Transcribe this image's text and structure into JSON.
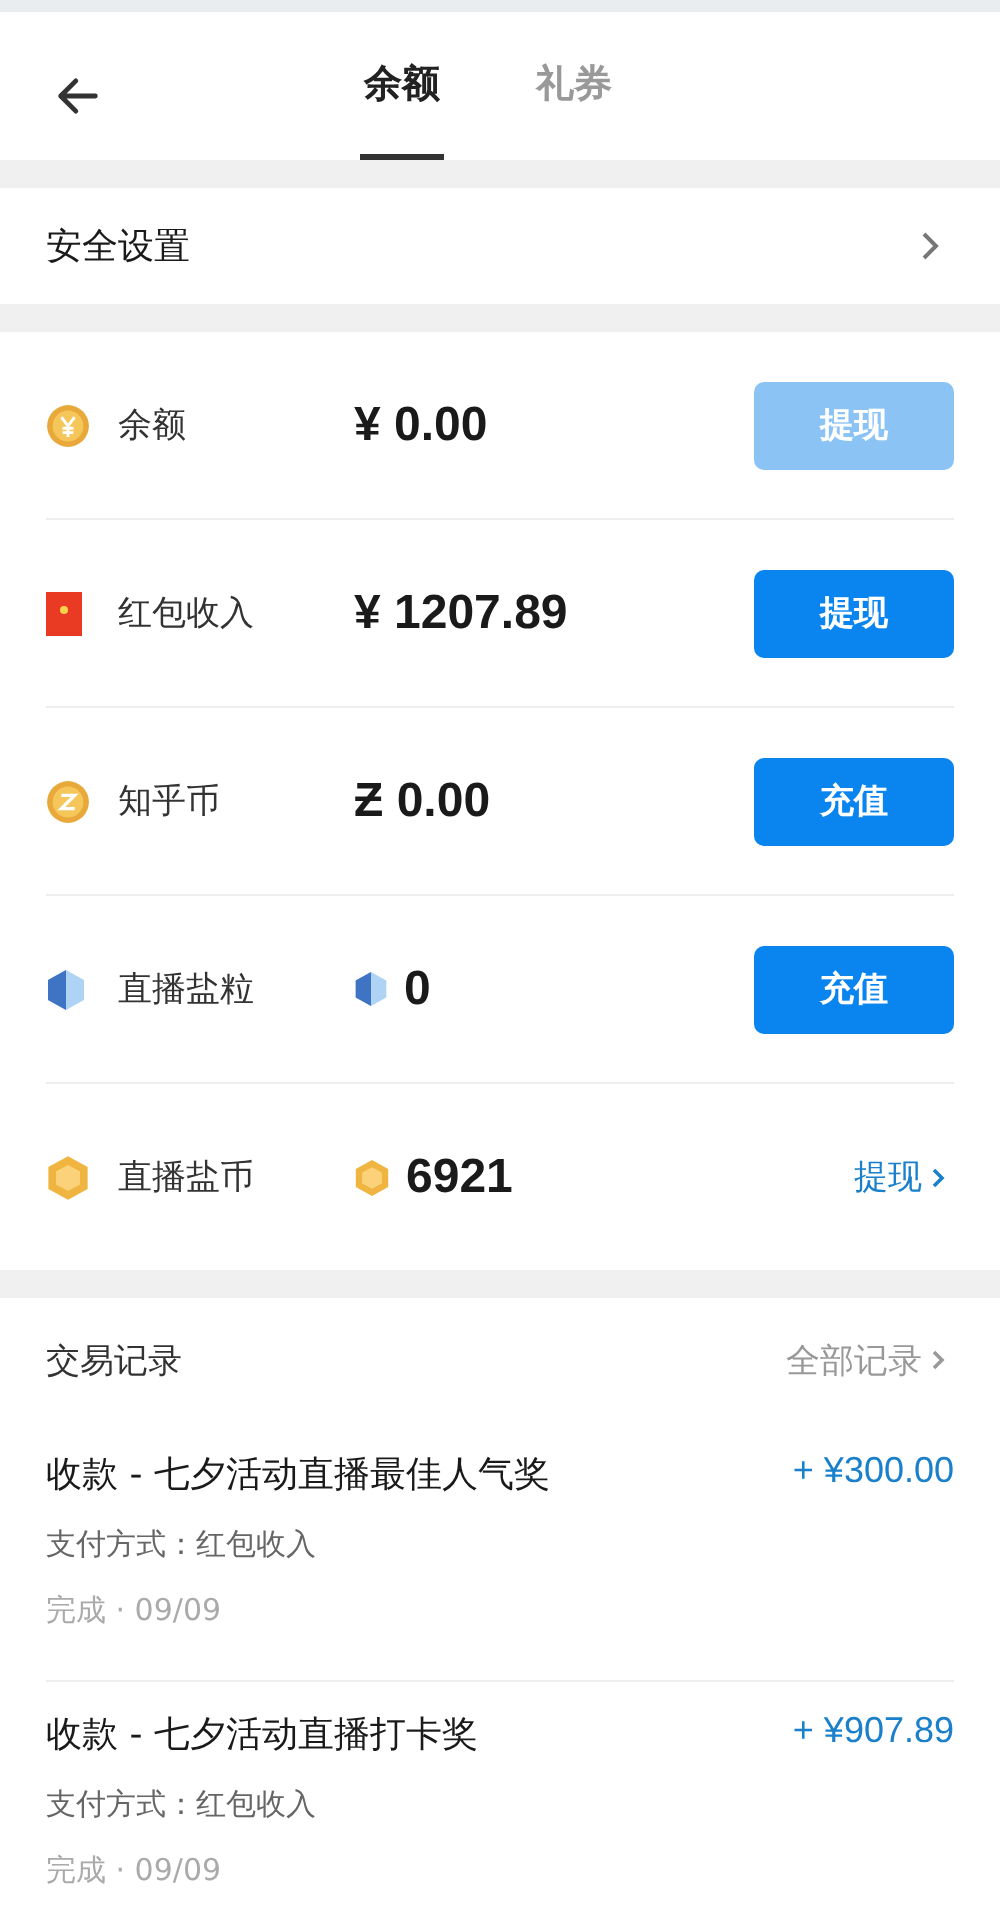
{
  "tabs": [
    {
      "label": "余额",
      "selected": true
    },
    {
      "label": "礼券",
      "selected": false
    }
  ],
  "security": {
    "label": "安全设置"
  },
  "balances": [
    {
      "label": "余额",
      "amount": "¥ 0.00",
      "action": {
        "kind": "button",
        "label": "提现",
        "disabled": true
      }
    },
    {
      "label": "红包收入",
      "amount": "¥ 1207.89",
      "action": {
        "kind": "button",
        "label": "提现",
        "disabled": false
      }
    },
    {
      "label": "知乎币",
      "amount": "Ƶ 0.00",
      "action": {
        "kind": "button",
        "label": "充值",
        "disabled": false
      }
    },
    {
      "label": "直播盐粒",
      "amount": "0",
      "action": {
        "kind": "button",
        "label": "充值",
        "disabled": false
      }
    },
    {
      "label": "直播盐币",
      "amount": "6921",
      "action": {
        "kind": "link",
        "label": "提现"
      }
    }
  ],
  "transactions_header": {
    "title": "交易记录",
    "all_link": "全部记录"
  },
  "transactions": [
    {
      "title": "收款 - 七夕活动直播最佳人气奖",
      "amount": "+ ¥300.00",
      "method": "支付方式：红包收入",
      "status": "完成 · 09/09"
    },
    {
      "title": "收款 - 七夕活动直播打卡奖",
      "amount": "+ ¥907.89",
      "method": "支付方式：红包收入",
      "status": "完成 · 09/09"
    }
  ]
}
